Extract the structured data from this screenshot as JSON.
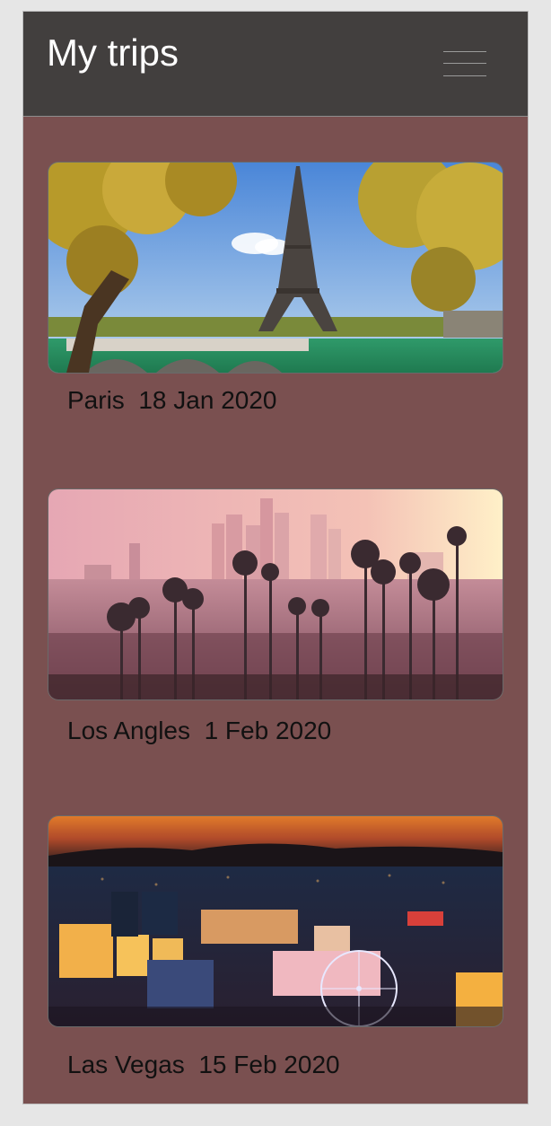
{
  "app": {
    "title": "My trips",
    "menu_icon": "hamburger-menu-icon"
  },
  "colors": {
    "header_bg": "#423f3e",
    "page_bg": "#7a5050",
    "title_text": "#ffffff",
    "caption_text": "#111111"
  },
  "trips": [
    {
      "city": "Paris",
      "date": "18 Jan 2020",
      "photo": "paris-eiffel-tower-photo"
    },
    {
      "city": "Los Angles",
      "date": "1 Feb 2020",
      "photo": "los-angeles-skyline-photo"
    },
    {
      "city": "Las Vegas",
      "date": "15 Feb 2020",
      "photo": "las-vegas-night-photo"
    }
  ]
}
